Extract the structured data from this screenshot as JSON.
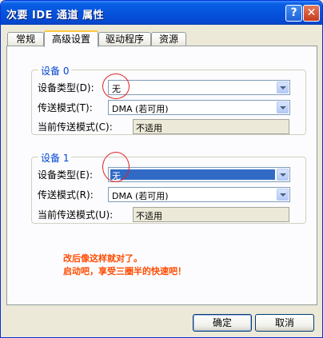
{
  "window": {
    "title": "次要 IDE 通道 属性",
    "help_label": "?",
    "close_label": "✕"
  },
  "tabs": [
    {
      "label": "常规"
    },
    {
      "label": "高级设置",
      "active": true
    },
    {
      "label": "驱动程序"
    },
    {
      "label": "资源"
    }
  ],
  "device0": {
    "legend": "设备 0",
    "type_label": "设备类型(D):",
    "type_value": "无",
    "transfer_label": "传送模式(T):",
    "transfer_value": "DMA (若可用)",
    "current_label": "当前传送模式(C):",
    "current_value": "不适用"
  },
  "device1": {
    "legend": "设备 1",
    "type_label": "设备类型(E):",
    "type_value": "无",
    "transfer_label": "传送模式(R):",
    "transfer_value": "DMA (若可用)",
    "current_label": "当前传送模式(U):",
    "current_value": "不适用"
  },
  "annotation": {
    "line1": "改后像这样就对了。",
    "line2": "启动吧，享受三圈半的快速吧！"
  },
  "buttons": {
    "ok": "确定",
    "cancel": "取消"
  },
  "colors": {
    "titlebar": "#0553dd",
    "accent_blue": "#0046d5",
    "selection": "#316ac5",
    "annotation_text": "#ff4b00",
    "circle": "#e02020"
  }
}
